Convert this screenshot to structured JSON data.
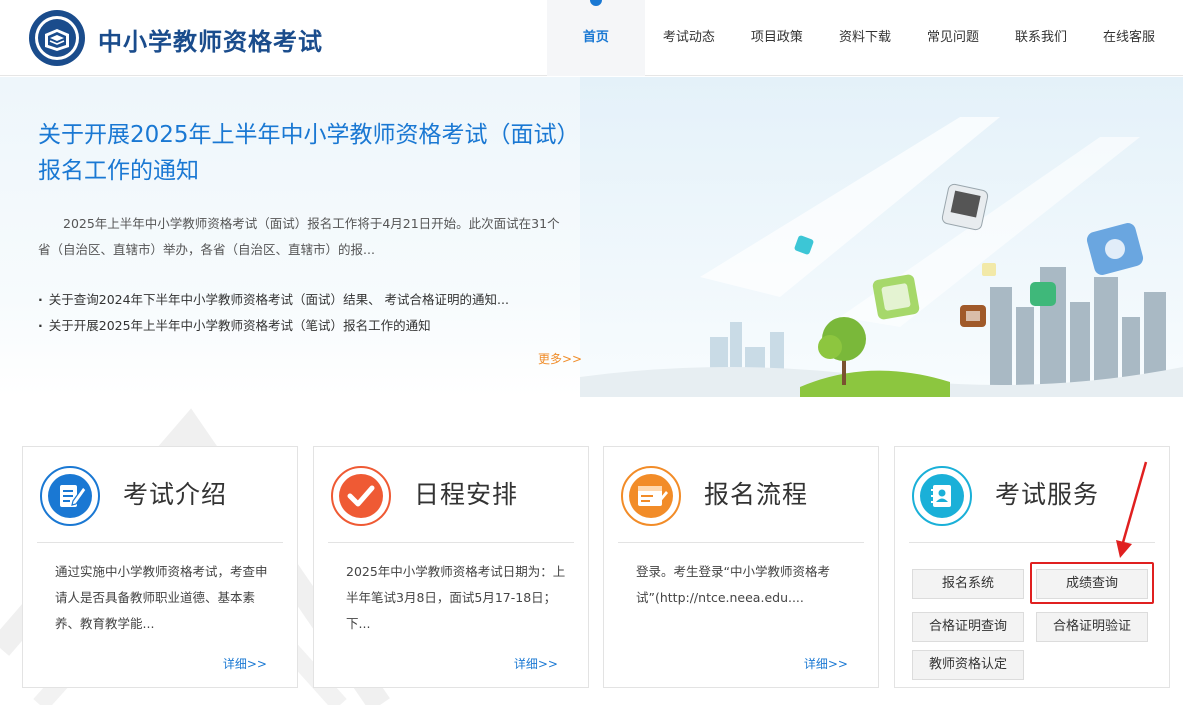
{
  "header": {
    "site_title": "中小学教师资格考试",
    "nav": [
      "首页",
      "考试动态",
      "项目政策",
      "资料下载",
      "常见问题",
      "联系我们",
      "在线客服"
    ]
  },
  "banner": {
    "headline": "关于开展2025年上半年中小学教师资格考试（面试）报名工作的通知",
    "summary": "2025年上半年中小学教师资格考试（面试）报名工作将于4月21日开始。此次面试在31个省（自治区、直辖市）举办，各省（自治区、直辖市）的报...",
    "news": [
      "关于查询2024年下半年中小学教师资格考试（面试）结果、 考试合格证明的通知...",
      "关于开展2025年上半年中小学教师资格考试（笔试）报名工作的通知"
    ],
    "more": "更多>>"
  },
  "cards": {
    "intro": {
      "title": "考试介绍",
      "body": "通过实施中小学教师资格考试，考查申请人是否具备教师职业道德、基本素养、教育教学能...",
      "more": "详细>>"
    },
    "schedule": {
      "title": "日程安排",
      "body": "2025年中小学教师资格考试日期为：上半年笔试3月8日，面试5月17-18日；下...",
      "more": "详细>>"
    },
    "process": {
      "title": "报名流程",
      "body": "登录。考生登录“中小学教师资格考试”(http://ntce.neea.edu....",
      "more": "详细>>"
    },
    "service": {
      "title": "考试服务",
      "buttons": [
        "报名系统",
        "成绩查询",
        "合格证明查询",
        "合格证明验证",
        "教师资格认定"
      ]
    }
  },
  "colors": {
    "brand": "#1a4c8c",
    "accent": "#1a78d3",
    "more_orange": "#f08d2a",
    "highlight_red": "#e02020"
  }
}
